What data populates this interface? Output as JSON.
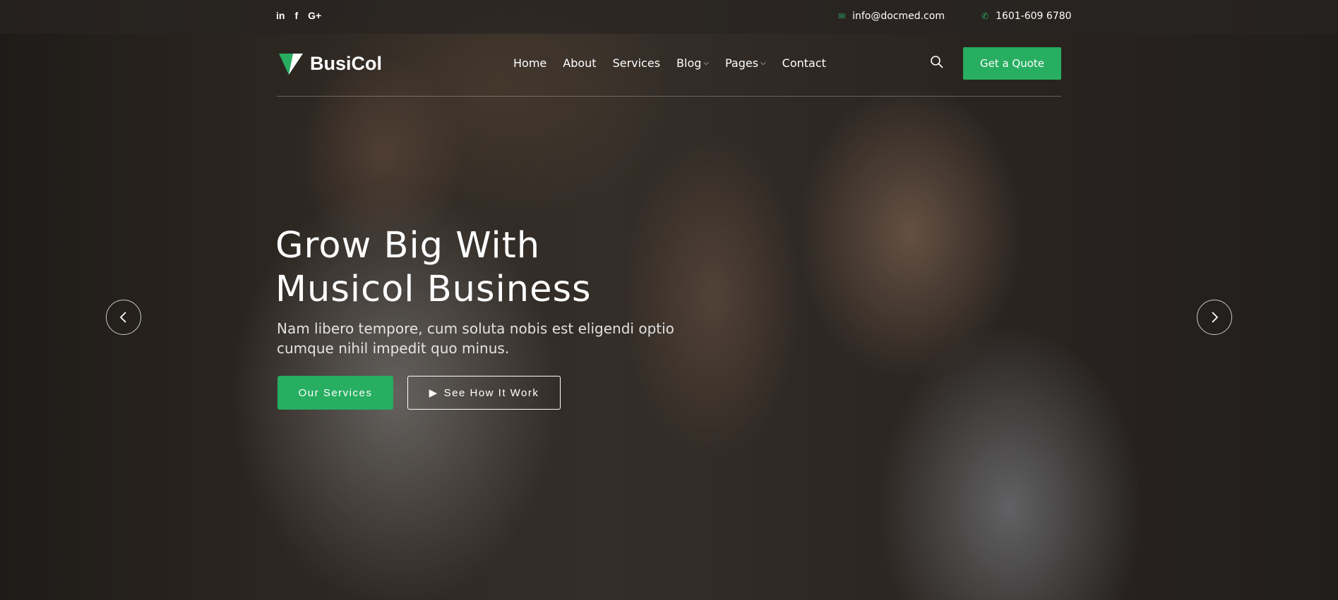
{
  "topbar": {
    "social": [
      "in",
      "f",
      "G+"
    ],
    "email": "info@docmed.com",
    "phone": "1601-609 6780"
  },
  "brand": {
    "name": "BusiCol",
    "accent": "#27ae60"
  },
  "nav": {
    "items": [
      {
        "label": "Home"
      },
      {
        "label": "About"
      },
      {
        "label": "Services"
      },
      {
        "label": "Blog"
      },
      {
        "label": "Pages"
      },
      {
        "label": "Contact"
      }
    ],
    "cta": "Get a Quote"
  },
  "hero": {
    "title_line1": "Grow Big With",
    "title_line2": "Musicol Business",
    "subtitle": "Nam libero tempore, cum soluta nobis est eligendi optio cumque nihil impedit quo minus.",
    "primary_button": "Our Services",
    "secondary_button": "See How It Work"
  }
}
